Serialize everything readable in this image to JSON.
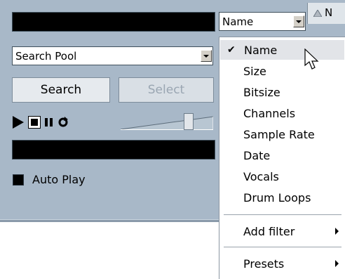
{
  "search_field": {
    "value": ""
  },
  "attribute_dropdown": {
    "selected": "Name"
  },
  "column_header": {
    "label": "N"
  },
  "pool_dropdown": {
    "selected": "Search Pool"
  },
  "buttons": {
    "search": "Search",
    "select": "Select"
  },
  "transport": {
    "play_icon": "play-icon",
    "stop_icon": "stop-icon",
    "pause_icon": "pause-icon",
    "cycle_icon": "cycle-icon"
  },
  "volume_slider": {
    "level": 0.75
  },
  "progress_field": {
    "value": ""
  },
  "auto_play": {
    "label": "Auto Play",
    "checked": false
  },
  "menu": {
    "items": [
      "Name",
      "Size",
      "Bitsize",
      "Channels",
      "Sample Rate",
      "Date",
      "Vocals",
      "Drum Loops"
    ],
    "checked": "Name",
    "add_filter": "Add filter",
    "presets": "Presets"
  }
}
